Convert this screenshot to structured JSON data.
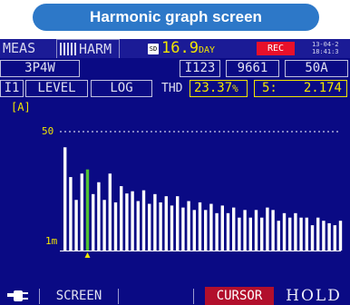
{
  "caption": "Harmonic graph screen",
  "header": {
    "tab_meas": "MEAS",
    "tab_harm": "HARM",
    "sd_icon": "SD",
    "days_value": "16.9",
    "days_unit": "DAY",
    "rec": "REC",
    "clock_date": "13-04-2",
    "clock_time": "18:41:3"
  },
  "row2": {
    "wiring": "3P4W",
    "channel": "I123",
    "value": "9661",
    "range": "50A"
  },
  "row3": {
    "item": "I1",
    "level": "LEVEL",
    "scale": "LOG",
    "thd_label": "THD",
    "thd_value": "23.37",
    "thd_unit": "%",
    "order_label": "5:",
    "order_value": "2.174"
  },
  "chart_data": {
    "type": "bar",
    "unit": "[A]",
    "y_scale": "log",
    "ytick_top": "50",
    "ytick_bottom": "1m",
    "reference_line": 50,
    "selected_index": 4,
    "values": [
      12.0,
      0.8,
      0.1,
      1.1,
      1.6,
      0.17,
      0.5,
      0.1,
      1.1,
      0.08,
      0.35,
      0.18,
      0.22,
      0.09,
      0.24,
      0.07,
      0.17,
      0.08,
      0.14,
      0.06,
      0.14,
      0.05,
      0.09,
      0.04,
      0.08,
      0.04,
      0.07,
      0.03,
      0.06,
      0.03,
      0.05,
      0.02,
      0.04,
      0.02,
      0.04,
      0.02,
      0.05,
      0.04,
      0.015,
      0.03,
      0.02,
      0.03,
      0.02,
      0.02,
      0.01,
      0.02,
      0.015,
      0.012,
      0.01,
      0.015
    ],
    "colors": {
      "bar": "#ffffff",
      "selected": "#4fc234",
      "reference": "#ffffff",
      "axis": "#ffffff",
      "cursor": "#f2e600"
    }
  },
  "bottom": {
    "plug_icon": "plug-icon",
    "screen": "SCREEN",
    "blank": "",
    "cursor": "CURSOR",
    "hold": "HOLD"
  }
}
